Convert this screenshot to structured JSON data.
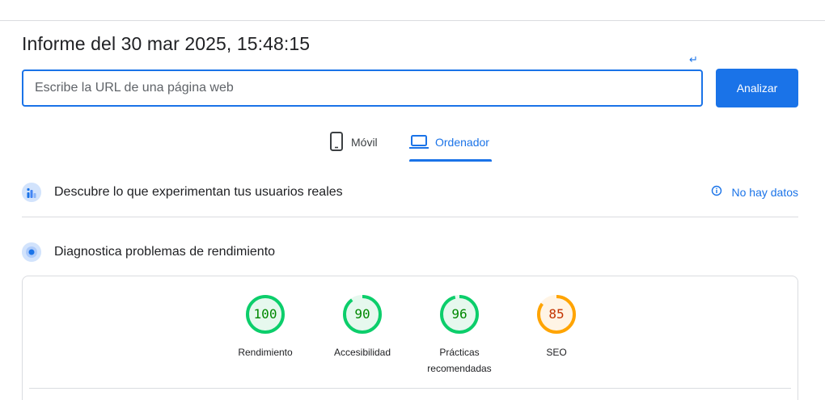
{
  "report": {
    "title": "Informe del 30 mar 2025, 15:48:15",
    "enter_hint": "↵"
  },
  "search": {
    "placeholder": "Escribe la URL de una página web",
    "value": "",
    "button_label": "Analizar"
  },
  "tabs": [
    {
      "label": "Móvil",
      "icon": "phone-icon",
      "selected": false
    },
    {
      "label": "Ordenador",
      "icon": "laptop-icon",
      "selected": true
    }
  ],
  "crux": {
    "title": "Descubre lo que experimentan tus usuarios reales",
    "icon": "users-chart-icon",
    "status_label": "No hay datos",
    "status_icon": "info-icon"
  },
  "diagnostics": {
    "title": "Diagnostica problemas de rendimiento",
    "icon": "lighthouse-icon"
  },
  "scores": [
    {
      "value": "100",
      "score": 100,
      "label": "Rendimiento",
      "color": "#0cce6b",
      "text_color": "#008800",
      "bg": "#e6f8ee"
    },
    {
      "value": "90",
      "score": 90,
      "label": "Accesibilidad",
      "color": "#0cce6b",
      "text_color": "#008800",
      "bg": "#e6f8ee"
    },
    {
      "value": "96",
      "score": 96,
      "label": "Prácticas recomendadas",
      "color": "#0cce6b",
      "text_color": "#008800",
      "bg": "#e6f8ee"
    },
    {
      "value": "85",
      "score": 85,
      "label": "SEO",
      "color": "#ffa400",
      "text_color": "#c33300",
      "bg": "#fff4e5"
    }
  ],
  "colors": {
    "accent": "#1a73e8",
    "pass": "#0cce6b",
    "average": "#ffa400"
  }
}
